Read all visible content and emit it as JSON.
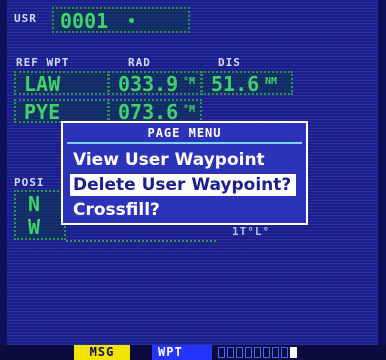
{
  "header": {
    "usr_label": "USR",
    "waypoint_id": "0001",
    "waypoint_type_icon": "dot-icon"
  },
  "columns": {
    "ref_wpt": "REF WPT",
    "rad": "RAD",
    "dis": "DIS"
  },
  "rows": [
    {
      "ref": "LAW",
      "rad": "033.9",
      "rad_unit": "°M",
      "dis": "51.6",
      "dis_unit": "NM"
    },
    {
      "ref": "PYE",
      "rad": "073.6",
      "rad_unit": "°M",
      "dis": "",
      "dis_unit": ""
    }
  ],
  "position": {
    "label": "POSI",
    "lat_prefix": "N",
    "lon_prefix": "W",
    "partial_text": "1T°L°"
  },
  "menu": {
    "title": "PAGE MENU",
    "items": [
      {
        "label": "View User Waypoint List?",
        "selected": false
      },
      {
        "label": "Delete User Waypoint?",
        "selected": true
      },
      {
        "label": "Crossfill?",
        "selected": false
      }
    ]
  },
  "status_bar": {
    "msg": "MSG",
    "page": "WPT",
    "page_count": 9,
    "active_page": 9
  },
  "colors": {
    "background": "#1a1f92",
    "field_text": "#3fd468",
    "msg_highlight": "#f2e400",
    "selection": "#ffffff"
  }
}
